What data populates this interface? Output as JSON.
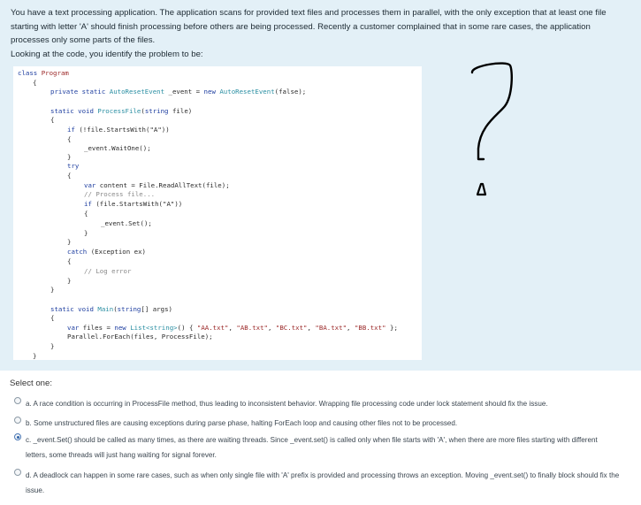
{
  "question": {
    "line1": "You have a text processing application. The application scans for provided text files and processes them in parallel, with the only exception that at least one file",
    "line2": "starting with letter 'A' should finish processing before others are being processed. Recently a customer complained that in some rare cases, the application",
    "line3": "processes only some parts of the files.",
    "line4": "Looking at the code, you identify the problem to be:"
  },
  "code": {
    "l1_kw": "class",
    "l1_name": "Program",
    "l2": "{",
    "l3_kw": "private static",
    "l3_type": "AutoResetEvent",
    "l3_mid": " _event = ",
    "l3_kw2": "new",
    "l3_type2": "AutoResetEvent",
    "l3_end": "(false);",
    "l4_kw": "static void",
    "l4_name": "ProcessFile",
    "l4_open": "(",
    "l4_kw2": "string",
    "l4_end": " file)",
    "l5": "{",
    "l6_kw": "if",
    "l6_end": " (!file.StartsWith(\"A\"))",
    "l7": "{",
    "l8": "_event.WaitOne();",
    "l9": "}",
    "l10_kw": "try",
    "l11": "{",
    "l12_kw": "var",
    "l12_end": " content = File.ReadAllText(file);",
    "l13": "// Process file...",
    "l14_kw": "if",
    "l14_end": " (file.StartsWith(\"A\"))",
    "l15": "{",
    "l16": "_event.Set();",
    "l17": "}",
    "l18": "}",
    "l19_kw": "catch",
    "l19_end": " (Exception ex)",
    "l20": "{",
    "l21": "// Log error",
    "l22": "}",
    "l23": "}",
    "l24_kw": "static void",
    "l24_name": "Main",
    "l24_open": "(",
    "l24_kw2": "string",
    "l24_end": "[] args)",
    "l25": "{",
    "l26_kw": "var",
    "l26_mid": " files = ",
    "l26_kw2": "new",
    "l26_type": " List<string>",
    "l26_open": "() { ",
    "l26_s1": "\"AA.txt\"",
    "l26_s2": "\"AB.txt\"",
    "l26_s3": "\"BC.txt\"",
    "l26_s4": "\"BA.txt\"",
    "l26_s5": "\"BB.txt\"",
    "l26_close": " };",
    "l27": "Parallel.ForEach(files, ProcessFile);",
    "l28": "}",
    "l29": "}"
  },
  "answers": {
    "prompt": "Select one:",
    "options": [
      {
        "text": "a. A race condition is occurring in ProcessFile method, thus leading to inconsistent behavior. Wrapping file processing code under lock statement should fix the issue.",
        "checked": false
      },
      {
        "text": "b. Some unstructured files are causing exceptions during parse phase, halting ForEach loop and causing other files not to be processed.",
        "checked": false
      },
      {
        "text": "c. _event.Set() should be called as many times, as there are waiting threads. Since _event.set() is called only when file starts with 'A', when there are more files starting with different letters, some threads will just hang waiting for signal forever.",
        "checked": true
      },
      {
        "text": "d. A deadlock can happen in some rare cases, such as when only single file with 'A' prefix is provided and processing throws an exception. Moving _event.set() to finally block should fix the issue.",
        "checked": false
      }
    ]
  },
  "colors": {
    "question_bg": "#e3f0f7",
    "keyword": "#1f3fa0",
    "type": "#2b8fa3",
    "string": "#9c2a2a",
    "comment": "#8a8a8a",
    "radio_selected": "#2e62a8"
  },
  "icons": {
    "doodle": "hand-drawn-question-mark"
  }
}
